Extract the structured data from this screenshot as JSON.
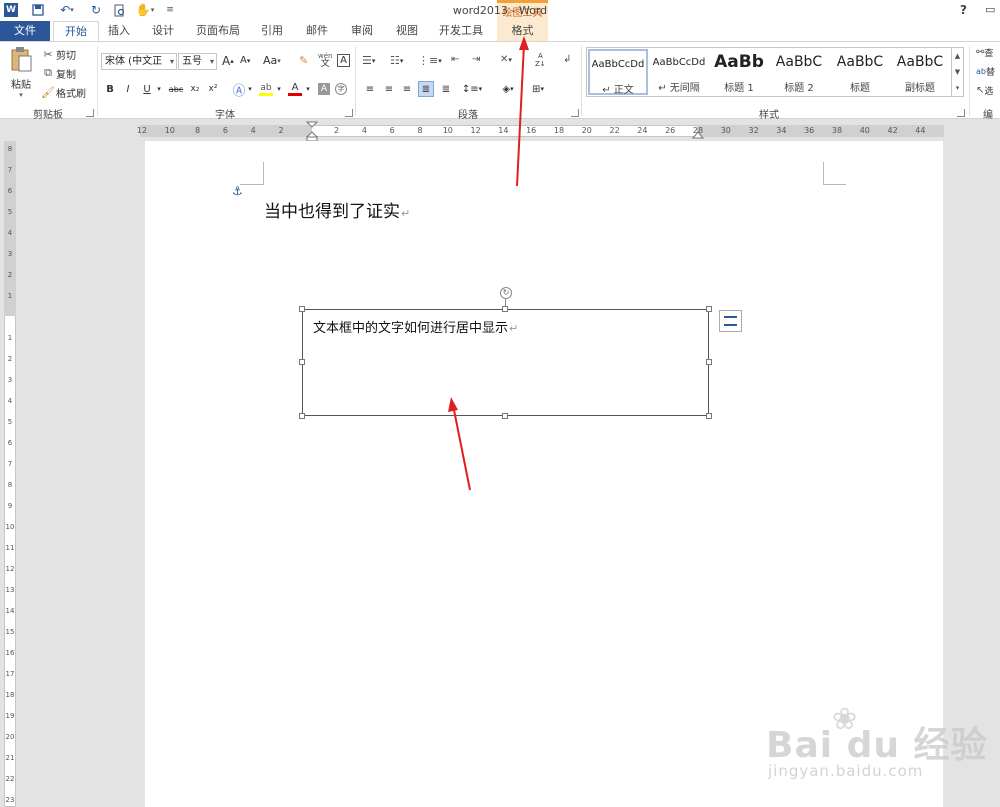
{
  "titlebar": {
    "doc_title": "word2013 - Word",
    "context_group": "绘图工具",
    "help": "?"
  },
  "tabs": [
    {
      "id": "file",
      "label": "文件"
    },
    {
      "id": "home",
      "label": "开始"
    },
    {
      "id": "insert",
      "label": "插入"
    },
    {
      "id": "design",
      "label": "设计"
    },
    {
      "id": "layout",
      "label": "页面布局"
    },
    {
      "id": "references",
      "label": "引用"
    },
    {
      "id": "mailings",
      "label": "邮件"
    },
    {
      "id": "review",
      "label": "审阅"
    },
    {
      "id": "view",
      "label": "视图"
    },
    {
      "id": "developer",
      "label": "开发工具"
    },
    {
      "id": "format",
      "label": "格式"
    }
  ],
  "clipboard": {
    "paste": "粘贴",
    "cut": "剪切",
    "copy": "复制",
    "format_painter": "格式刷",
    "group_label": "剪贴板"
  },
  "font": {
    "font_name": "宋体 (中文正",
    "font_size": "五号",
    "group_label": "字体",
    "bold": "B",
    "italic": "I",
    "underline": "U",
    "strike": "abc",
    "subscript": "x₂",
    "superscript": "x²",
    "grow": "A",
    "shrink": "A",
    "case": "Aa",
    "phonetic": "wén",
    "char_border": "A",
    "char_shade": "A",
    "enclose": "字"
  },
  "paragraph": {
    "group_label": "段落"
  },
  "styles": {
    "group_label": "样式",
    "items": [
      {
        "sample": "AaBbCcDd",
        "name": "↵ 正文",
        "selected": true
      },
      {
        "sample": "AaBbCcDd",
        "name": "↵ 无间隔",
        "selected": false
      },
      {
        "sample": "AaBb",
        "name": "标题 1",
        "selected": false
      },
      {
        "sample": "AaBbC",
        "name": "标题 2",
        "selected": false
      },
      {
        "sample": "AaBbC",
        "name": "标题",
        "selected": false
      },
      {
        "sample": "AaBbC",
        "name": "副标题",
        "selected": false
      }
    ]
  },
  "editing": {
    "find": "查",
    "replace": "替",
    "select": "选",
    "group_label": "编"
  },
  "ruler": {
    "h_numbers": [
      "12",
      "10",
      "8",
      "6",
      "4",
      "2",
      "",
      "2",
      "4",
      "6",
      "8",
      "10",
      "12",
      "14",
      "16",
      "18",
      "20",
      "22",
      "24",
      "26",
      "28",
      "30",
      "32",
      "34",
      "36",
      "38",
      "40",
      "42",
      "44"
    ],
    "v_numbers": [
      "8",
      "7",
      "6",
      "5",
      "4",
      "3",
      "2",
      "1",
      "",
      "1",
      "2",
      "3",
      "4",
      "5",
      "6",
      "7",
      "8",
      "9",
      "10",
      "11",
      "12",
      "13",
      "14",
      "15",
      "16",
      "17",
      "18",
      "19",
      "20",
      "21",
      "22",
      "23"
    ],
    "corner": "L"
  },
  "document": {
    "body_text": "当中也得到了证实",
    "textbox_text": "文本框中的文字如何进行居中显示",
    "paragraph_mark": "↵"
  },
  "watermark": {
    "main": "Bai du 经验",
    "sub": "jingyan.baidu.com"
  },
  "colors": {
    "word_blue": "#2b579a",
    "context_orange": "#d2691e",
    "context_bg": "#fbeacf",
    "arrow_red": "#e02020",
    "highlight_yellow": "#ffff00",
    "font_red": "#e00000"
  }
}
